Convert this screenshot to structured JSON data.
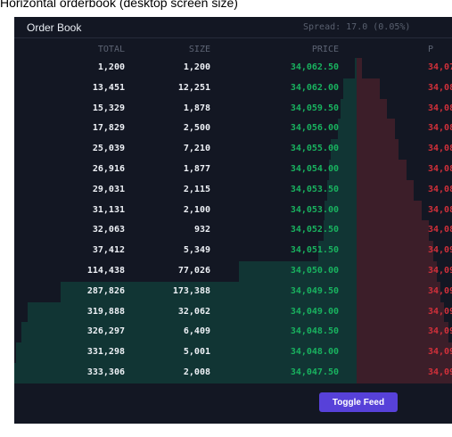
{
  "caption": "Horizontal orderbook (desktop screen size)",
  "header": {
    "title": "Order Book",
    "spread": "Spread: 17.0 (0.05%)"
  },
  "columns": {
    "total": "TOTAL",
    "size": "SIZE",
    "price": "PRICE",
    "price_right": "P"
  },
  "bids": [
    {
      "total": "1,200",
      "size": "1,200",
      "price": "34,062.50"
    },
    {
      "total": "13,451",
      "size": "12,251",
      "price": "34,062.00"
    },
    {
      "total": "15,329",
      "size": "1,878",
      "price": "34,059.50"
    },
    {
      "total": "17,829",
      "size": "2,500",
      "price": "34,056.00"
    },
    {
      "total": "25,039",
      "size": "7,210",
      "price": "34,055.00"
    },
    {
      "total": "26,916",
      "size": "1,877",
      "price": "34,054.00"
    },
    {
      "total": "29,031",
      "size": "2,115",
      "price": "34,053.50"
    },
    {
      "total": "31,131",
      "size": "2,100",
      "price": "34,053.00"
    },
    {
      "total": "32,063",
      "size": "932",
      "price": "34,052.50"
    },
    {
      "total": "37,412",
      "size": "5,349",
      "price": "34,051.50"
    },
    {
      "total": "114,438",
      "size": "77,026",
      "price": "34,050.00"
    },
    {
      "total": "287,826",
      "size": "173,388",
      "price": "34,049.50"
    },
    {
      "total": "319,888",
      "size": "32,062",
      "price": "34,049.00"
    },
    {
      "total": "326,297",
      "size": "6,409",
      "price": "34,048.50"
    },
    {
      "total": "331,298",
      "size": "5,001",
      "price": "34,048.00"
    },
    {
      "total": "333,306",
      "size": "2,008",
      "price": "34,047.50"
    }
  ],
  "asks": [
    {
      "price": "34,07"
    },
    {
      "price": "34,08"
    },
    {
      "price": "34,08"
    },
    {
      "price": "34,08"
    },
    {
      "price": "34,08"
    },
    {
      "price": "34,08"
    },
    {
      "price": "34,08"
    },
    {
      "price": "34,08"
    },
    {
      "price": "34,08"
    },
    {
      "price": "34,09"
    },
    {
      "price": "34,09"
    },
    {
      "price": "34,09"
    },
    {
      "price": "34,09"
    },
    {
      "price": "34,09"
    },
    {
      "price": "34,09"
    },
    {
      "price": "34,09"
    }
  ],
  "ask_depth_fraction": [
    0.03,
    0.12,
    0.16,
    0.2,
    0.22,
    0.26,
    0.3,
    0.34,
    0.38,
    0.4,
    0.42,
    0.44,
    0.46,
    0.48,
    0.5,
    0.52
  ],
  "colors": {
    "bid_price": "#19b25f",
    "ask_price": "#d1303a",
    "bid_depth": "#113534",
    "ask_depth": "#3c1e29",
    "button": "#5741d9"
  },
  "footer": {
    "toggle_label": "Toggle Feed"
  }
}
